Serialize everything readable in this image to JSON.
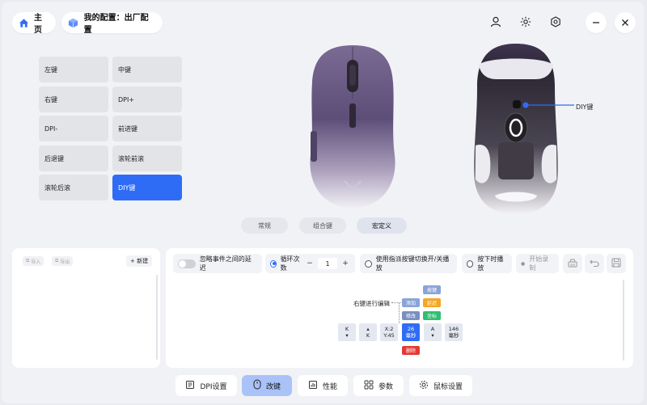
{
  "header": {
    "home_label": "主页",
    "profile_label": "我的配置：出厂配置"
  },
  "keys": [
    {
      "label": "左键"
    },
    {
      "label": "中键"
    },
    {
      "label": "右键"
    },
    {
      "label": "DPI+"
    },
    {
      "label": "DPI-"
    },
    {
      "label": "前进键"
    },
    {
      "label": "后退键"
    },
    {
      "label": "滚轮前滚"
    },
    {
      "label": "滚轮后滚"
    },
    {
      "label": "DIY键"
    }
  ],
  "selected_key": "DIY键",
  "mouse": {
    "diy_callout": "DIY键",
    "body_color": "#6b5a86"
  },
  "mode_tabs": {
    "normal": "常规",
    "combo": "组合键",
    "macro": "宏定义"
  },
  "macro_list": {
    "import": "导入",
    "export": "导出",
    "new": "+ 新建"
  },
  "options": {
    "ignore_delay": "忽略事件之间的延迟",
    "loop_count": "循环次数",
    "loop_value": "1",
    "minus": "−",
    "plus": "+",
    "toggle_play": "使用指派按键切换开/关播放",
    "hold_play": "按下时播放",
    "record": "开始录制"
  },
  "editor": {
    "hint": "右键进行编辑",
    "btn_key": "按键",
    "btn_add": "添加",
    "btn_delay": "延迟",
    "btn_modify": "修改",
    "btn_coord": "坐标",
    "btn_delete": "删除",
    "seq": [
      {
        "top": "K",
        "bottom": "▾"
      },
      {
        "top": "▴",
        "bottom": "K"
      },
      {
        "top": "X:2",
        "bottom": "Y:45"
      },
      {
        "top": "26",
        "bottom": "毫秒"
      },
      {
        "top": "A",
        "bottom": "▾"
      },
      {
        "top": "146",
        "bottom": "毫秒"
      }
    ]
  },
  "bottom_nav": {
    "dpi": "DPI设置",
    "remap": "改键",
    "perf": "性能",
    "params": "参数",
    "mouse_settings": "鼠标设置"
  },
  "colors": {
    "accent": "#2f6cf6",
    "add": "#8aa4d6",
    "delay": "#f5a623",
    "modify": "#7a8fc0",
    "coord": "#2fbf71",
    "delete": "#e53935"
  }
}
